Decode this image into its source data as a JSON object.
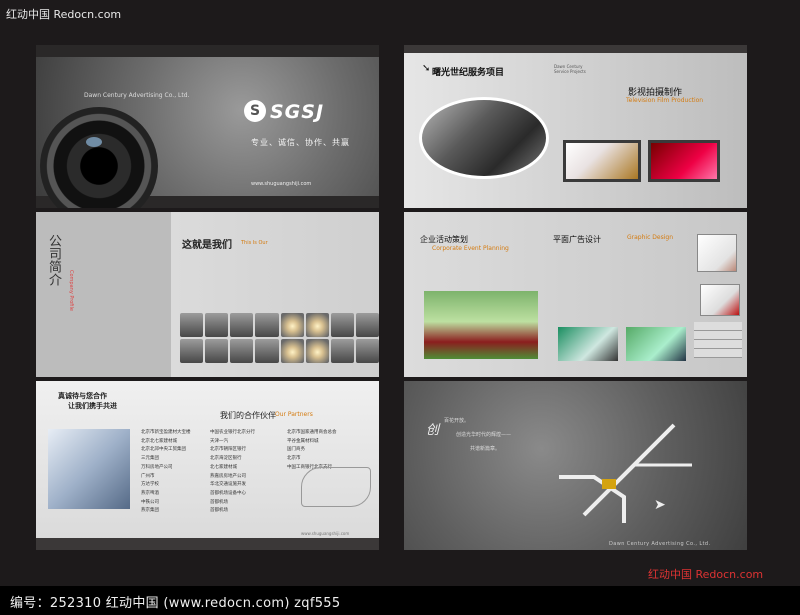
{
  "watermark_top": "红动中国 Redocn.com",
  "watermark_bottom": "红动中国 Redocn.com",
  "footer": {
    "text": "编号：252310    红动中国 (www.redocn.com)    zqf555"
  },
  "cover": {
    "company": "Dawn Century Advertising Co., Ltd.",
    "logo_text": "SGSJ",
    "slogan": "专业、诚信、协作、共赢",
    "website": "www.shuguangshiji.com"
  },
  "about": {
    "vertical_title": "公司简介",
    "vertical_sub": "Company Profile",
    "heading": "这就是我们",
    "heading_en": "This Is Our"
  },
  "partners": {
    "slogan_1": "真诚待与您合作",
    "slogan_2": "让我们携手共进",
    "heading": "我们的合作伙伴",
    "heading_en": "Our Partners",
    "list_col1": [
      "北京市新宝盈建材大宝楼",
      "北京北七家建材城",
      "北京北郊中央工贸集团",
      "三元集团",
      "万科房地产公司",
      "广州市",
      "方达学校",
      "燕京啤酒",
      "中铁公司",
      "燕京集团"
    ],
    "list_col2": [
      "中国农业银行北京分行",
      "天津一汽",
      "北京市朝阳区银行",
      "北京海淀区银行",
      "北七家建材城",
      "燕嘉房房地产公司",
      "华北交通设施开发",
      "首都机场设备中心",
      "首都机场",
      "首都机场"
    ],
    "list_col3": [
      "北京市国家通用商会总会",
      "平谷金属材料城",
      "国门商务",
      "北京市",
      "中国工商银行北京支行"
    ],
    "website": "www.shuguangshiji.com"
  },
  "services": {
    "heading": "曙光世纪服务项目",
    "sub_en_1": "Dawn Century",
    "sub_en_2": "Service Projects",
    "tv_heading": "影视拍摄制作",
    "tv_heading_en": "Television Film Production"
  },
  "events": {
    "event_heading": "企业活动策划",
    "event_heading_en": "Corporate Event Planning",
    "ad_heading": "平面广告设计",
    "ad_heading_en": "Graphic Design"
  },
  "mappanel": {
    "big_char": "创",
    "line_1": "百花开放。",
    "line_2": "创造光华时代的辉煌——",
    "line_3": "共谱新篇章。",
    "company": "Dawn Century Advertising Co., Ltd.",
    "right_co": "Dawn Century Advertising Co., Ltd."
  },
  "colors": {
    "accent": "#d47b10",
    "background": "#1d1a1b",
    "footer": "#000000"
  }
}
